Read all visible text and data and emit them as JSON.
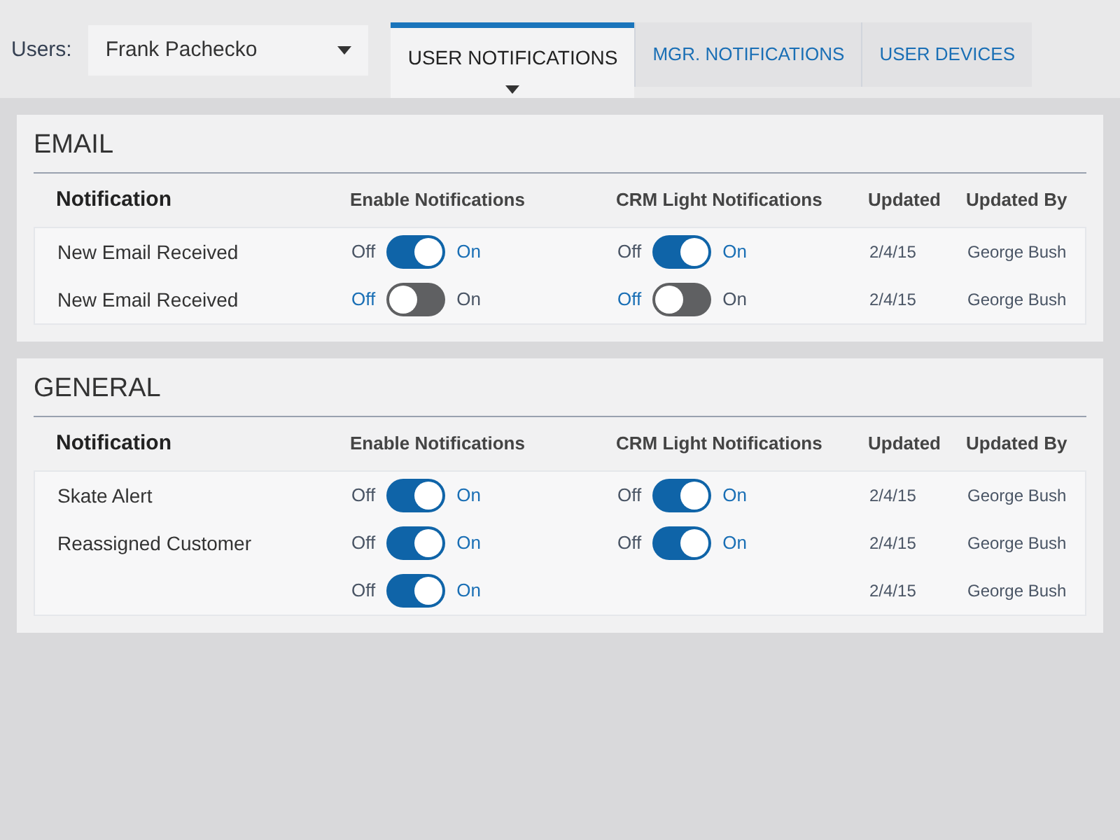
{
  "user_picker": {
    "label": "Users:",
    "value": "Frank Pachecko"
  },
  "tabs": [
    {
      "label": "USER NOTIFICATIONS",
      "selected": true
    },
    {
      "label": "MGR. NOTIFICATIONS",
      "selected": false
    },
    {
      "label": "USER DEVICES",
      "selected": false
    }
  ],
  "sections": [
    {
      "title": "EMAIL",
      "columns": [
        "Notification",
        "Enable Notifications",
        "CRM Light Notifications",
        "Updated",
        "Updated By"
      ],
      "rows": [
        {
          "name": "New Email Received",
          "enable": {
            "off_label": "Off",
            "on_label": "On",
            "on": true
          },
          "crm": {
            "off_label": "Off",
            "on_label": "On",
            "on": true
          },
          "updated": "2/4/15",
          "updated_by": "George Bush"
        },
        {
          "name": "New Email Received",
          "enable": {
            "off_label": "Off",
            "on_label": "On",
            "on": false
          },
          "crm": {
            "off_label": "Off",
            "on_label": "On",
            "on": false
          },
          "updated": "2/4/15",
          "updated_by": "George Bush"
        }
      ]
    },
    {
      "title": "GENERAL",
      "columns": [
        "Notification",
        "Enable Notifications",
        "CRM Light Notifications",
        "Updated",
        "Updated By"
      ],
      "rows": [
        {
          "name": "Skate Alert",
          "enable": {
            "off_label": "Off",
            "on_label": "On",
            "on": true
          },
          "crm": {
            "off_label": "Off",
            "on_label": "On",
            "on": true
          },
          "updated": "2/4/15",
          "updated_by": "George Bush"
        },
        {
          "name": "Reassigned Customer",
          "enable": {
            "off_label": "Off",
            "on_label": "On",
            "on": true
          },
          "crm": {
            "off_label": "Off",
            "on_label": "On",
            "on": true
          },
          "updated": "2/4/15",
          "updated_by": "George Bush"
        },
        {
          "enable": {
            "off_label": "Off",
            "on_label": "On",
            "on": true
          },
          "updated": "2/4/15",
          "updated_by": "George Bush"
        }
      ]
    }
  ]
}
